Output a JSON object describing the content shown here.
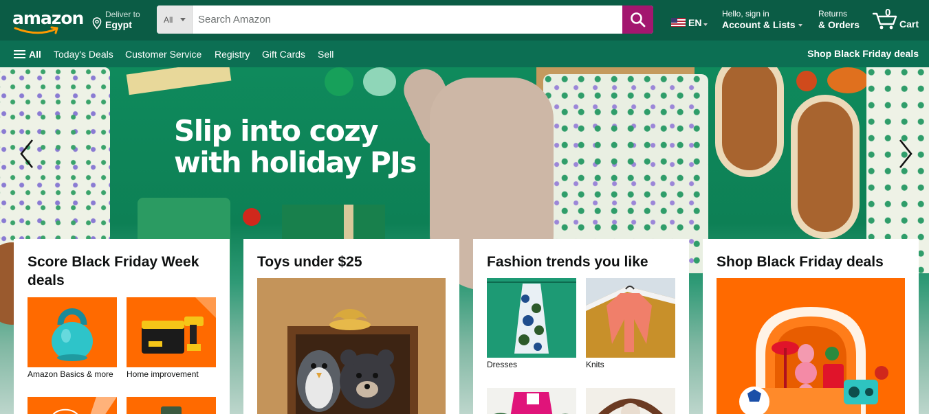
{
  "header": {
    "logo_text": "amazon",
    "deliver_to_label": "Deliver to",
    "deliver_to_location": "Egypt",
    "search": {
      "category": "All",
      "placeholder": "Search Amazon"
    },
    "language": "EN",
    "account_greeting": "Hello, sign in",
    "account_label": "Account & Lists",
    "returns_label": "Returns",
    "orders_label": "& Orders",
    "cart_count": "0",
    "cart_label": "Cart"
  },
  "nav": {
    "all_label": "All",
    "links": [
      "Today's Deals",
      "Customer Service",
      "Registry",
      "Gift Cards",
      "Sell"
    ],
    "promo": "Shop Black Friday deals"
  },
  "hero": {
    "headline_line1": "Slip into cozy",
    "headline_line2": "with holiday PJs"
  },
  "cards": [
    {
      "title": "Score Black Friday Week deals",
      "tiles": [
        {
          "caption": "Amazon Basics & more",
          "icon": "kettlebell-image"
        },
        {
          "caption": "Home improvement",
          "icon": "power-drill-image"
        }
      ]
    },
    {
      "title": "Toys under $25",
      "icon": "plush-toys-image"
    },
    {
      "title": "Fashion trends you like",
      "tiles": [
        {
          "caption": "Dresses",
          "icon": "dress-image"
        },
        {
          "caption": "Knits",
          "icon": "knit-top-image"
        }
      ]
    },
    {
      "title": "Shop Black Friday deals",
      "icon": "home-decor-image"
    }
  ],
  "colors": {
    "header_bg": "#0b5c45",
    "nav_bg": "#0c6f53",
    "search_button": "#a3166f",
    "deal_orange": "#ff6a00"
  }
}
